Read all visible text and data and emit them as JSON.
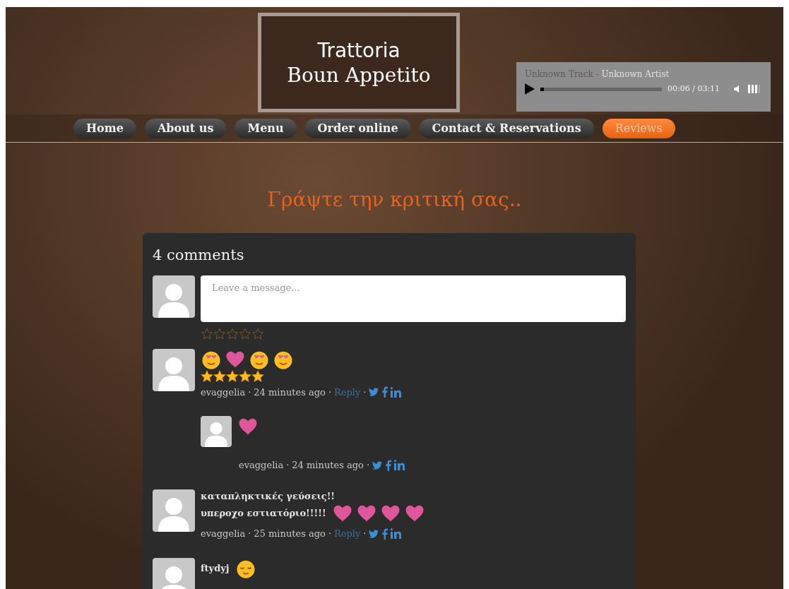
{
  "logo": {
    "line_1": "Trattoria",
    "line_2": "Boun Appetito"
  },
  "player": {
    "track": "Unknown Track",
    "separator": " - ",
    "artist": "Unknown Artist",
    "time": "00:06 / 03:11",
    "level": 0.02
  },
  "nav": [
    {
      "label": "Home",
      "selected": false
    },
    {
      "label": "About us",
      "selected": false
    },
    {
      "label": "Menu",
      "selected": false
    },
    {
      "label": "Order online",
      "selected": false
    },
    {
      "label": "Contact & Reservations",
      "selected": false
    },
    {
      "label": "Reviews",
      "selected": true
    }
  ],
  "heading": "Γράψτε την κριτική σας..",
  "comments_box": {
    "count": "4 comments",
    "placeholder": "Leave a message...",
    "stars": 0,
    "comments": [
      {
        "emojis": [
          {
            "kind": "heart-eyes"
          },
          {
            "kind": "heart"
          },
          {
            "kind": "heart-eyes"
          },
          {
            "kind": "heart-eyes"
          }
        ],
        "stars": 5,
        "author": "evaggelia",
        "time": "24 minutes ago",
        "reply": "Reply",
        "separators": [
          "·",
          "·",
          "·"
        ],
        "children": [
          {
            "emojis": [
              {
                "kind": "heart"
              }
            ],
            "author": "evaggelia",
            "time": "24 minutes ago",
            "separators": [
              "·",
              "·"
            ]
          }
        ]
      },
      {
        "lines": [
          "καταπληκτικές γεύσεις!!",
          "υπεροχο εστιατόριο!!!!!"
        ],
        "emojis": [
          {
            "kind": "heart"
          },
          {
            "kind": "heart"
          },
          {
            "kind": "heart"
          },
          {
            "kind": "heart"
          }
        ],
        "author": "evaggelia",
        "time": "25 minutes ago",
        "reply": "Reply",
        "separators": [
          "·",
          "·",
          "·"
        ]
      },
      {
        "lines": [
          "ftydyj"
        ],
        "emojis": [
          {
            "kind": "content-face"
          }
        ]
      }
    ]
  }
}
